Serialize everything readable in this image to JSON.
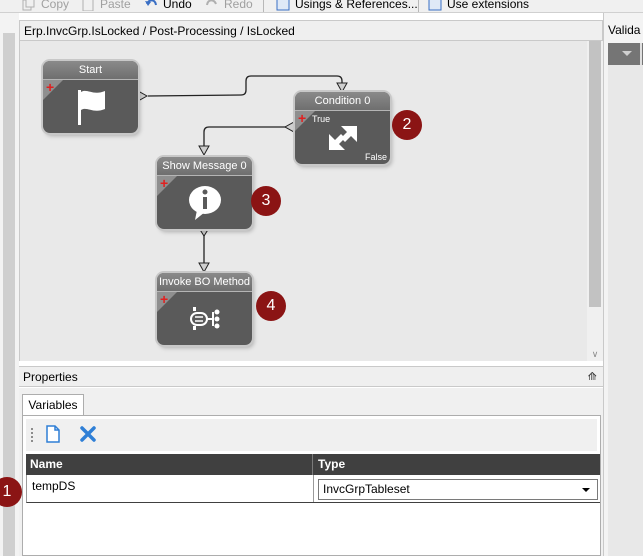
{
  "toolbar": {
    "copy_label": "Copy",
    "paste_label": "Paste",
    "undo_label": "Undo",
    "redo_label": "Redo",
    "usings_label": "Usings & References...",
    "extensions_label": "Use extensions"
  },
  "designer": {
    "breadcrumb": "Erp.InvcGrp.IsLocked / Post-Processing / IsLocked"
  },
  "right_panel": {
    "title": "Valida"
  },
  "nodes": {
    "start": {
      "title": "Start",
      "icon": "flag-icon"
    },
    "condition": {
      "title": "Condition 0",
      "true_label": "True",
      "false_label": "False",
      "icon": "condition-arrows-icon"
    },
    "show_message": {
      "title": "Show Message 0",
      "icon": "info-bubble-icon"
    },
    "invoke_bo": {
      "title": "Invoke BO Method",
      "icon": "invoke-method-icon"
    }
  },
  "badges": {
    "one": "1",
    "two": "2",
    "three": "3",
    "four": "4"
  },
  "properties": {
    "title": "Properties",
    "pin_glyph": "📌",
    "tab_variables": "Variables",
    "grid": {
      "col_name": "Name",
      "col_type": "Type",
      "rows": [
        {
          "name": "tempDS",
          "type": "InvcGrpTableset"
        }
      ]
    }
  },
  "colors": {
    "badge": "#8b1414",
    "node_body": "#5a5a5a",
    "grid_header": "#404040",
    "delete_icon": "#2f7fd6"
  }
}
